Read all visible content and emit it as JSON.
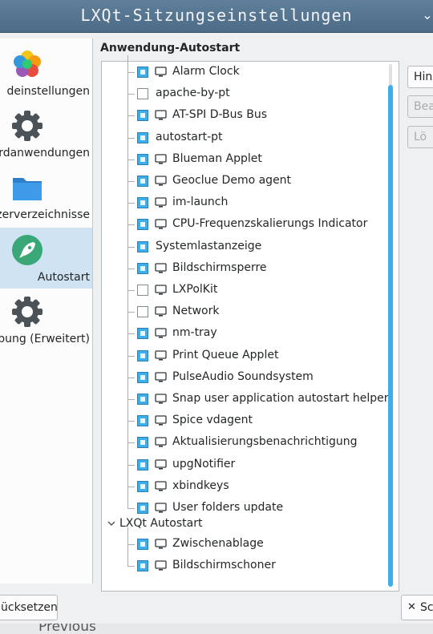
{
  "window": {
    "title": "LXQt-Sitzungseinstellungen",
    "menu_glyph": "⌄"
  },
  "sidebar": {
    "items": [
      {
        "label": "deinstellungen",
        "icon": "flower-icon",
        "selected": false
      },
      {
        "label": "ardanwendungen",
        "icon": "gear-icon",
        "selected": false
      },
      {
        "label": "zerverzeichnisse",
        "icon": "folder-icon",
        "selected": false
      },
      {
        "label": "Autostart",
        "icon": "rocket-icon",
        "selected": true
      },
      {
        "label": "bung (Erweitert)",
        "icon": "gear-icon",
        "selected": false
      }
    ]
  },
  "panel": {
    "title": "Anwendung-Autostart",
    "group1": {
      "items": [
        {
          "label": "Alarm Clock",
          "checked": true,
          "icon": "monitor-icon"
        },
        {
          "label": "apache-by-pt",
          "checked": false,
          "icon": ""
        },
        {
          "label": "AT-SPI D-Bus Bus",
          "checked": true,
          "icon": "monitor-icon"
        },
        {
          "label": "autostart-pt",
          "checked": true,
          "icon": ""
        },
        {
          "label": "Blueman Applet",
          "checked": true,
          "icon": "monitor-icon"
        },
        {
          "label": "Geoclue Demo agent",
          "checked": true,
          "icon": "monitor-icon"
        },
        {
          "label": "im-launch",
          "checked": true,
          "icon": "monitor-icon"
        },
        {
          "label": "CPU-Frequenzskalierungs Indicator",
          "checked": true,
          "icon": "monitor-icon"
        },
        {
          "label": "Systemlastanzeige",
          "checked": true,
          "icon": ""
        },
        {
          "label": "Bildschirmsperre",
          "checked": true,
          "icon": "monitor-icon"
        },
        {
          "label": "LXPolKit",
          "checked": false,
          "icon": "monitor-icon"
        },
        {
          "label": "Network",
          "checked": false,
          "icon": "monitor-icon"
        },
        {
          "label": "nm-tray",
          "checked": true,
          "icon": "monitor-icon"
        },
        {
          "label": "Print Queue Applet",
          "checked": true,
          "icon": "monitor-icon"
        },
        {
          "label": "PulseAudio Soundsystem",
          "checked": true,
          "icon": "monitor-icon"
        },
        {
          "label": "Snap user application autostart helper",
          "checked": true,
          "icon": "monitor-icon"
        },
        {
          "label": "Spice vdagent",
          "checked": true,
          "icon": "monitor-icon"
        },
        {
          "label": "Aktualisierungsbenachrichtigung",
          "checked": true,
          "icon": "monitor-icon"
        },
        {
          "label": "upgNotifier",
          "checked": true,
          "icon": "monitor-icon"
        },
        {
          "label": "xbindkeys",
          "checked": true,
          "icon": "monitor-icon"
        },
        {
          "label": "User folders update",
          "checked": true,
          "icon": "monitor-icon"
        }
      ]
    },
    "group2": {
      "label": "LXQt Autostart",
      "items": [
        {
          "label": "Zwischenablage",
          "checked": true,
          "icon": "monitor-icon"
        },
        {
          "label": "Bildschirmschoner",
          "checked": true,
          "icon": "monitor-icon"
        }
      ]
    }
  },
  "buttons": {
    "add": "Hinz",
    "edit": "Bea",
    "delete": "Lö",
    "reset": "ücksetzen",
    "close_glyph": "✕",
    "close": "Sc"
  },
  "behind_window": {
    "text": "Previous"
  },
  "colors": {
    "accent": "#3daee9",
    "titlebar": "#52708b",
    "selection": "#cfe3f3"
  }
}
